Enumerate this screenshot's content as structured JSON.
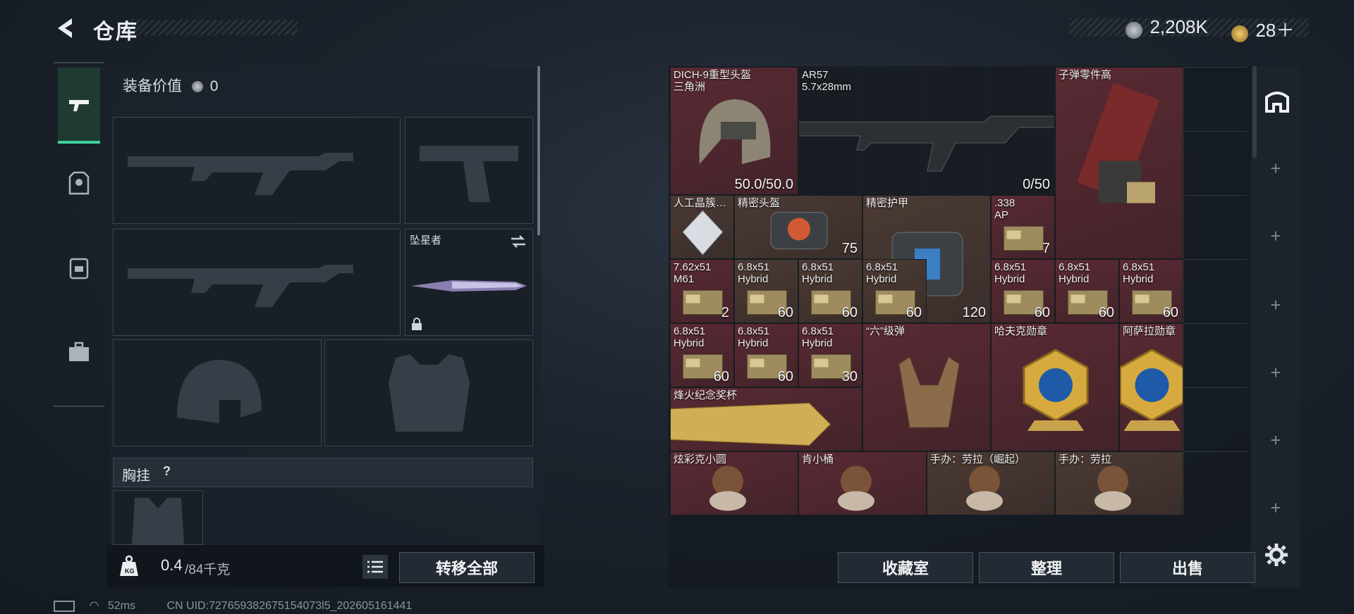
{
  "header": {
    "title": "仓库",
    "currency1": "2,208K",
    "currency2": "28＋"
  },
  "nav": {
    "items": [
      "weapon",
      "helmet-armor",
      "backpack",
      "toolbox"
    ]
  },
  "left": {
    "equip_value_label": "装备价值",
    "equip_value": "0",
    "knife_name": "坠星者",
    "chest_rig_label": "胸挂",
    "chest_rig_help": "?",
    "weight": "0.4",
    "weight_max": "/84千克",
    "transfer_all": "转移全部"
  },
  "items": [
    {
      "name": "DICH-9重型头盔\n三角洲",
      "count": "50.0/50.0",
      "color": "red",
      "icon": "helmet-icon"
    },
    {
      "name": "AR57\n5.7x28mm",
      "count": "0/50",
      "color": "dark",
      "icon": "rifle-icon"
    },
    {
      "name": "子弹零件高",
      "count": "",
      "color": "red",
      "icon": "ammo-parts-icon"
    },
    {
      "name": "人工晶簇…",
      "count": "",
      "color": "brown",
      "icon": "crystal-icon"
    },
    {
      "name": "精密头盔",
      "count": "75",
      "color": "brown",
      "icon": "precision-helmet-icon"
    },
    {
      "name": "精密护甲",
      "count": "120",
      "color": "brown",
      "icon": "precision-armor-icon"
    },
    {
      "name": ".338\nAP",
      "count": "7",
      "color": "red",
      "icon": "ammo-box-icon"
    },
    {
      "name": "7.62x51\nM61",
      "count": "2",
      "color": "red",
      "icon": "ammo-box-icon"
    },
    {
      "name": "6.8x51\nHybrid",
      "count": "60",
      "color": "brown",
      "icon": "ammo-box-icon"
    },
    {
      "name": "6.8x51\nHybrid",
      "count": "60",
      "color": "brown",
      "icon": "ammo-box-icon"
    },
    {
      "name": "6.8x51\nHybrid",
      "count": "60",
      "color": "brown",
      "icon": "ammo-box-icon"
    },
    {
      "name": "6.8x51\nHybrid",
      "count": "60",
      "color": "red",
      "icon": "ammo-box-icon"
    },
    {
      "name": "6.8x51\nHybrid",
      "count": "60",
      "color": "red",
      "icon": "ammo-box-icon"
    },
    {
      "name": "6.8x51\nHybrid",
      "count": "60",
      "color": "red",
      "icon": "ammo-box-icon"
    },
    {
      "name": "6.8x51\nHybrid",
      "count": "60",
      "color": "red",
      "icon": "ammo-box-icon"
    },
    {
      "name": "6.8x51\nHybrid",
      "count": "60",
      "color": "red",
      "icon": "ammo-box-icon"
    },
    {
      "name": "6.8x51\nHybrid",
      "count": "30",
      "color": "red",
      "icon": "ammo-box-icon"
    },
    {
      "name": "“六”级弹",
      "count": "",
      "color": "red",
      "icon": "hand-gesture-icon"
    },
    {
      "name": "哈夫克勋章",
      "count": "",
      "color": "red",
      "icon": "medal-icon"
    },
    {
      "name": "阿萨拉勋章",
      "count": "",
      "color": "red",
      "icon": "medal-icon"
    },
    {
      "name": "烽火纪念奖杯",
      "count": "",
      "color": "red",
      "icon": "trophy-icon"
    },
    {
      "name": "炫彩克小圆",
      "count": "",
      "color": "red",
      "icon": "figure-icon"
    },
    {
      "name": "肯小桶",
      "count": "",
      "color": "red",
      "icon": "figure-icon"
    },
    {
      "name": "手办：劳拉（崛起）",
      "count": "",
      "color": "brown",
      "icon": "figure-icon"
    },
    {
      "name": "手办：劳拉",
      "count": "",
      "color": "brown",
      "icon": "figure-icon"
    }
  ],
  "buttons": {
    "collection": "收藏室",
    "sort": "整理",
    "sell": "出售"
  },
  "status": {
    "ping": "52ms",
    "uid": "CN UID:727659382675154073l5_202605161441"
  }
}
